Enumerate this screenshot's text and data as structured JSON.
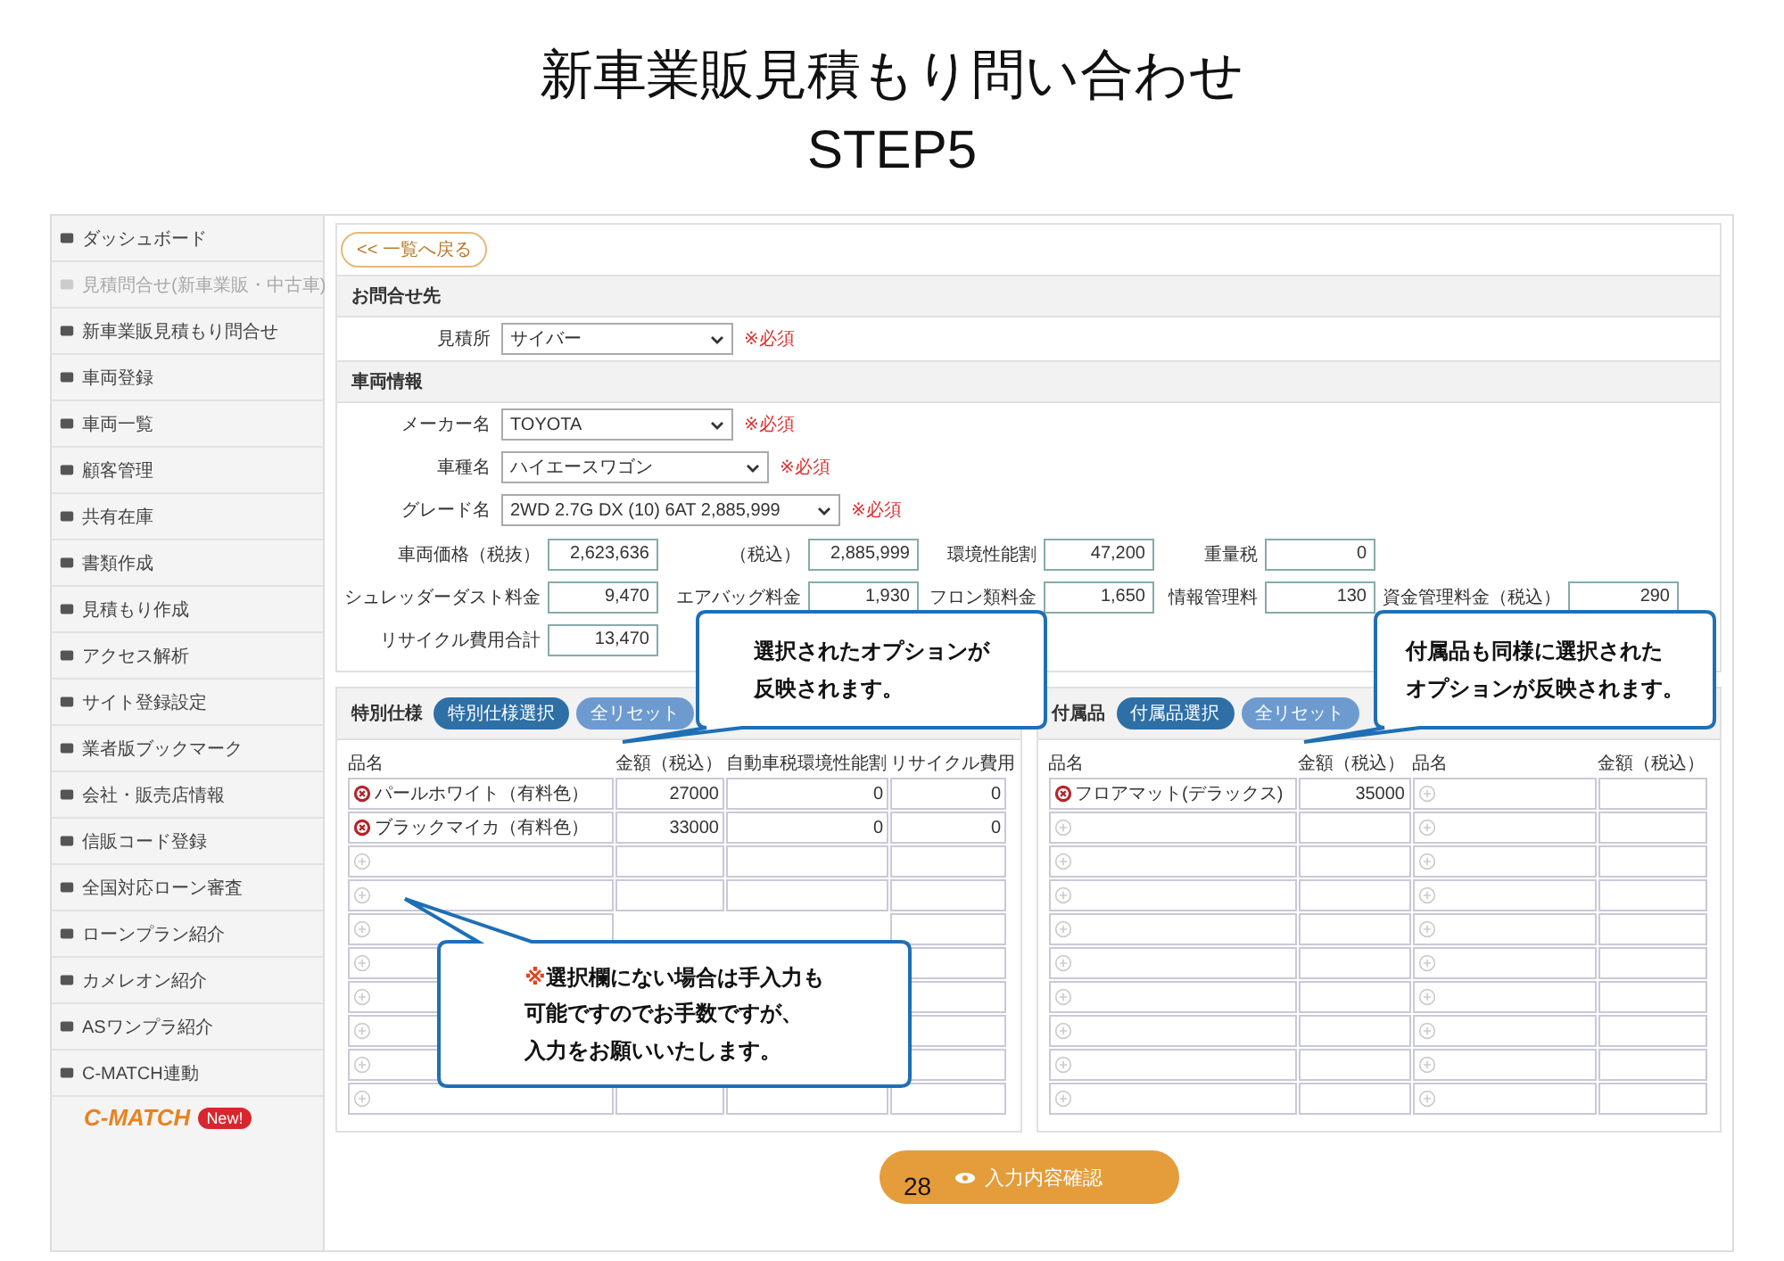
{
  "slide": {
    "title": "新車業販見積もり問い合わせ",
    "subtitle": "STEP5",
    "page_number": "28"
  },
  "sidebar": {
    "items": [
      {
        "label": "ダッシュボード",
        "disabled": false
      },
      {
        "label": "見積問合せ(新車業販・中古車)",
        "disabled": true
      },
      {
        "label": "新車業販見積もり問合せ",
        "disabled": false
      },
      {
        "label": "車両登録",
        "disabled": false
      },
      {
        "label": "車両一覧",
        "disabled": false
      },
      {
        "label": "顧客管理",
        "disabled": false
      },
      {
        "label": "共有在庫",
        "disabled": false
      },
      {
        "label": "書類作成",
        "disabled": false
      },
      {
        "label": "見積もり作成",
        "disabled": false
      },
      {
        "label": "アクセス解析",
        "disabled": false
      },
      {
        "label": "サイト登録設定",
        "disabled": false
      },
      {
        "label": "業者版ブックマーク",
        "disabled": false
      },
      {
        "label": "会社・販売店情報",
        "disabled": false
      },
      {
        "label": "信販コード登録",
        "disabled": false
      },
      {
        "label": "全国対応ローン審査",
        "disabled": false
      },
      {
        "label": "ローンプラン紹介",
        "disabled": false
      },
      {
        "label": "カメレオン紹介",
        "disabled": false
      },
      {
        "label": "ASワンプラ紹介",
        "disabled": false
      },
      {
        "label": "C-MATCH連動",
        "disabled": false
      }
    ],
    "logo": {
      "text": "C-MATCH",
      "badge": "New!"
    }
  },
  "back_button": "<< 一覧へ戻る",
  "contact": {
    "heading": "お問合せ先",
    "selects": [
      {
        "label": "見積所",
        "value": "サイバー",
        "required": "※必須"
      }
    ]
  },
  "vehicle": {
    "heading": "車両情報",
    "selects": [
      {
        "label": "メーカー名",
        "value": "TOYOTA",
        "required": "※必須"
      },
      {
        "label": "車種名",
        "value": "ハイエースワゴン",
        "required": "※必須"
      },
      {
        "label": "グレード名",
        "value": "2WD 2.7G DX (10) 6AT 2,885,999",
        "required": "※必須"
      }
    ],
    "rows": [
      [
        {
          "label": "車両価格（税抜）",
          "value": "2,623,636"
        },
        {
          "label": "（税込）",
          "value": "2,885,999"
        },
        {
          "label": "環境性能割",
          "value": "47,200"
        },
        {
          "label": "重量税",
          "value": "0"
        }
      ],
      [
        {
          "label": "シュレッダーダスト料金",
          "value": "9,470"
        },
        {
          "label": "エアバッグ料金",
          "value": "1,930"
        },
        {
          "label": "フロン類料金",
          "value": "1,650"
        },
        {
          "label": "情報管理料",
          "value": "130"
        },
        {
          "label": "資金管理料金（税込）",
          "value": "290"
        }
      ],
      [
        {
          "label": "リサイクル費用合計",
          "value": "13,470"
        }
      ]
    ]
  },
  "special": {
    "heading": "特別仕様",
    "buttons": [
      {
        "label": "特別仕様選択",
        "kind": "primary"
      },
      {
        "label": "全リセット",
        "kind": "secondary"
      }
    ],
    "columns": [
      "品名",
      "金額（税込）",
      "自動車税環境性能割",
      "リサイクル費用"
    ],
    "rows": [
      [
        {
          "kind": "filled",
          "cells": [
            "パールホワイト（有料色）",
            "27000",
            "0",
            "0"
          ]
        }
      ],
      [
        {
          "kind": "filled",
          "cells": [
            "ブラックマイカ（有料色）",
            "33000",
            "0",
            "0"
          ]
        }
      ],
      [
        {
          "kind": "empty"
        }
      ],
      [
        {
          "kind": "empty"
        }
      ],
      [
        {
          "kind": "empty"
        }
      ],
      [
        {
          "kind": "empty"
        }
      ],
      [
        {
          "kind": "empty"
        }
      ],
      [
        {
          "kind": "empty"
        }
      ],
      [
        {
          "kind": "empty"
        }
      ],
      [
        {
          "kind": "empty"
        }
      ]
    ]
  },
  "accessories": {
    "heading": "付属品",
    "buttons": [
      {
        "label": "付属品選択",
        "kind": "primary"
      },
      {
        "label": "全リセット",
        "kind": "secondary"
      }
    ],
    "columns": [
      "品名",
      "金額（税込）",
      "品名",
      "金額（税込）"
    ],
    "rows": [
      [
        {
          "kind": "filled",
          "cells": [
            "フロアマット(デラックス)",
            "35000"
          ]
        },
        {
          "kind": "empty"
        }
      ],
      [
        {
          "kind": "empty"
        },
        {
          "kind": "empty"
        }
      ],
      [
        {
          "kind": "empty"
        },
        {
          "kind": "empty"
        }
      ],
      [
        {
          "kind": "empty"
        },
        {
          "kind": "empty"
        }
      ],
      [
        {
          "kind": "empty"
        },
        {
          "kind": "empty"
        }
      ],
      [
        {
          "kind": "empty"
        },
        {
          "kind": "empty"
        }
      ],
      [
        {
          "kind": "empty"
        },
        {
          "kind": "empty"
        }
      ],
      [
        {
          "kind": "empty"
        },
        {
          "kind": "empty"
        }
      ],
      [
        {
          "kind": "empty"
        },
        {
          "kind": "empty"
        }
      ],
      [
        {
          "kind": "empty"
        },
        {
          "kind": "empty"
        }
      ]
    ]
  },
  "submit_button": "入力内容確認",
  "callouts": [
    {
      "lines": [
        "選択されたオプションが",
        "反映されます。"
      ]
    },
    {
      "lines": [
        "付属品も同様に選択された",
        "オプションが反映されます。"
      ]
    },
    {
      "mark": "※",
      "lines": [
        "選択欄にない場合は手入力も",
        "可能ですのでお手数ですが、",
        "入力をお願いいたします。"
      ]
    }
  ]
}
